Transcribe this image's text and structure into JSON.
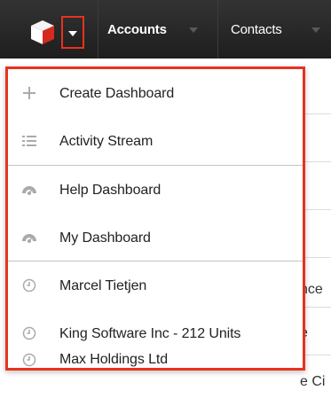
{
  "navbar": {
    "logo_icon": "sugar-cube-logo-icon",
    "menu_toggle_icon": "caret-down-icon",
    "tabs": [
      {
        "label": "Accounts"
      },
      {
        "label": "Contacts"
      }
    ],
    "highlight_color": "#e8321f"
  },
  "background": {
    "fragments": [
      "nce",
      "e",
      "e Ci"
    ]
  },
  "dropdown": {
    "sections": [
      {
        "items": [
          {
            "label": "Create Dashboard",
            "icon": "plus-icon"
          },
          {
            "label": "Activity Stream",
            "icon": "list-icon"
          }
        ]
      },
      {
        "items": [
          {
            "label": "Help Dashboard",
            "icon": "dashboard-gauge-icon"
          },
          {
            "label": "My Dashboard",
            "icon": "dashboard-gauge-icon"
          }
        ]
      },
      {
        "items": [
          {
            "label": "Marcel Tietjen",
            "icon": "clock-icon"
          },
          {
            "label": "King Software Inc - 212 Units",
            "icon": "clock-icon"
          },
          {
            "label": "Max Holdings Ltd",
            "icon": "clock-icon"
          }
        ]
      }
    ]
  }
}
